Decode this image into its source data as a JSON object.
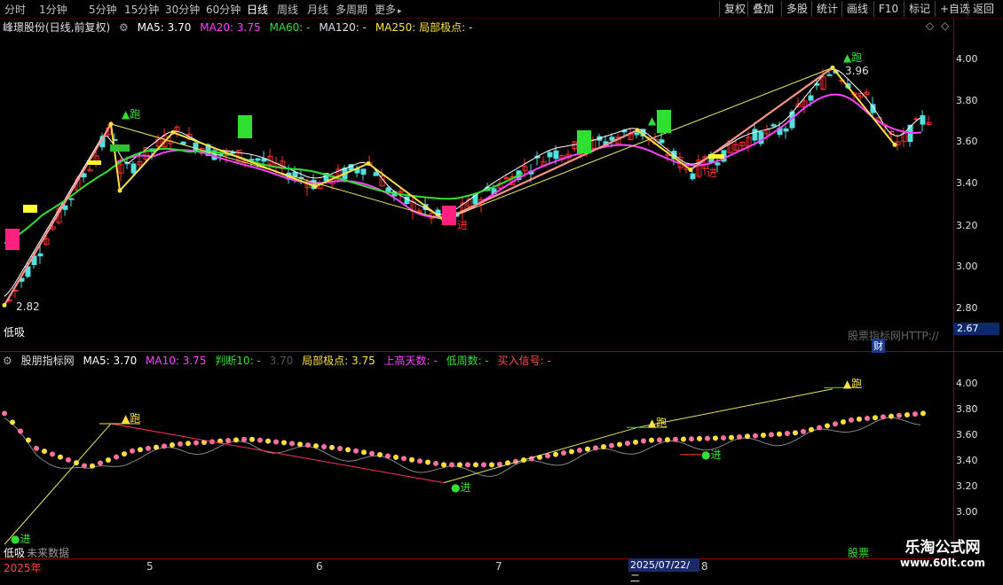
{
  "toolbar": {
    "periods": [
      "分时",
      "1分钟",
      "5分钟",
      "15分钟",
      "30分钟",
      "60分钟",
      "日线",
      "周线",
      "月线",
      "多周期",
      "更多"
    ],
    "more_arrow": "▸",
    "active_period": "日线",
    "tools": [
      "复权",
      "叠加",
      "多股",
      "统计",
      "画线",
      "F10",
      "标记",
      "+自选",
      "返回"
    ]
  },
  "main_panel": {
    "title": "峰璟股份(日线,前复权)",
    "ma5": "MA5: 3.70",
    "ma20": "MA20: 3.75",
    "ma60": "MA60: -",
    "ma120": "MA120: -",
    "ma250": "MA250: 局部极点: -",
    "y_ticks": [
      "4.00",
      "3.80",
      "3.60",
      "3.40",
      "3.20",
      "3.00",
      "2.80"
    ],
    "current_price": "2.67",
    "high_label": "3.96",
    "low_label": "2.82",
    "run_label": "▲跑",
    "enter_label": "进",
    "bottom_left": "低吸",
    "watermark_text": "股票指标网HTTP://",
    "fin_badge": "财"
  },
  "sub_panel": {
    "title": "股朋指标网",
    "ma5": "MA5: 3.70",
    "ma10": "MA10: 3.75",
    "judge": "判断10: -",
    "faded": "3.70",
    "extreme": "局部极点: 3.75",
    "up_days": "上高天数: -",
    "low_days": "低周数: -",
    "buy_signal": "买入信号: -",
    "y_ticks": [
      "4.00",
      "3.80",
      "3.60",
      "3.40",
      "3.20",
      "3.00"
    ],
    "run_label": "▲跑",
    "enter_label": "●进",
    "bottom_left": "低吸",
    "future_note": "未来数据",
    "bottom_right": "股票"
  },
  "xaxis": {
    "labels": [
      "2025年",
      "5",
      "6",
      "7",
      "8"
    ],
    "cursor_date": "2025/07/22/二"
  },
  "brand": {
    "name": "乐淘公式网",
    "url": "www.60lt.com"
  },
  "colors": {
    "up": "#ff3030",
    "down": "#50e0e0",
    "ma5": "#ffffff",
    "ma20": "#ff40ff",
    "ma60": "#30e030",
    "zigzag": "#ffe040",
    "pink": "#ff9090"
  }
}
